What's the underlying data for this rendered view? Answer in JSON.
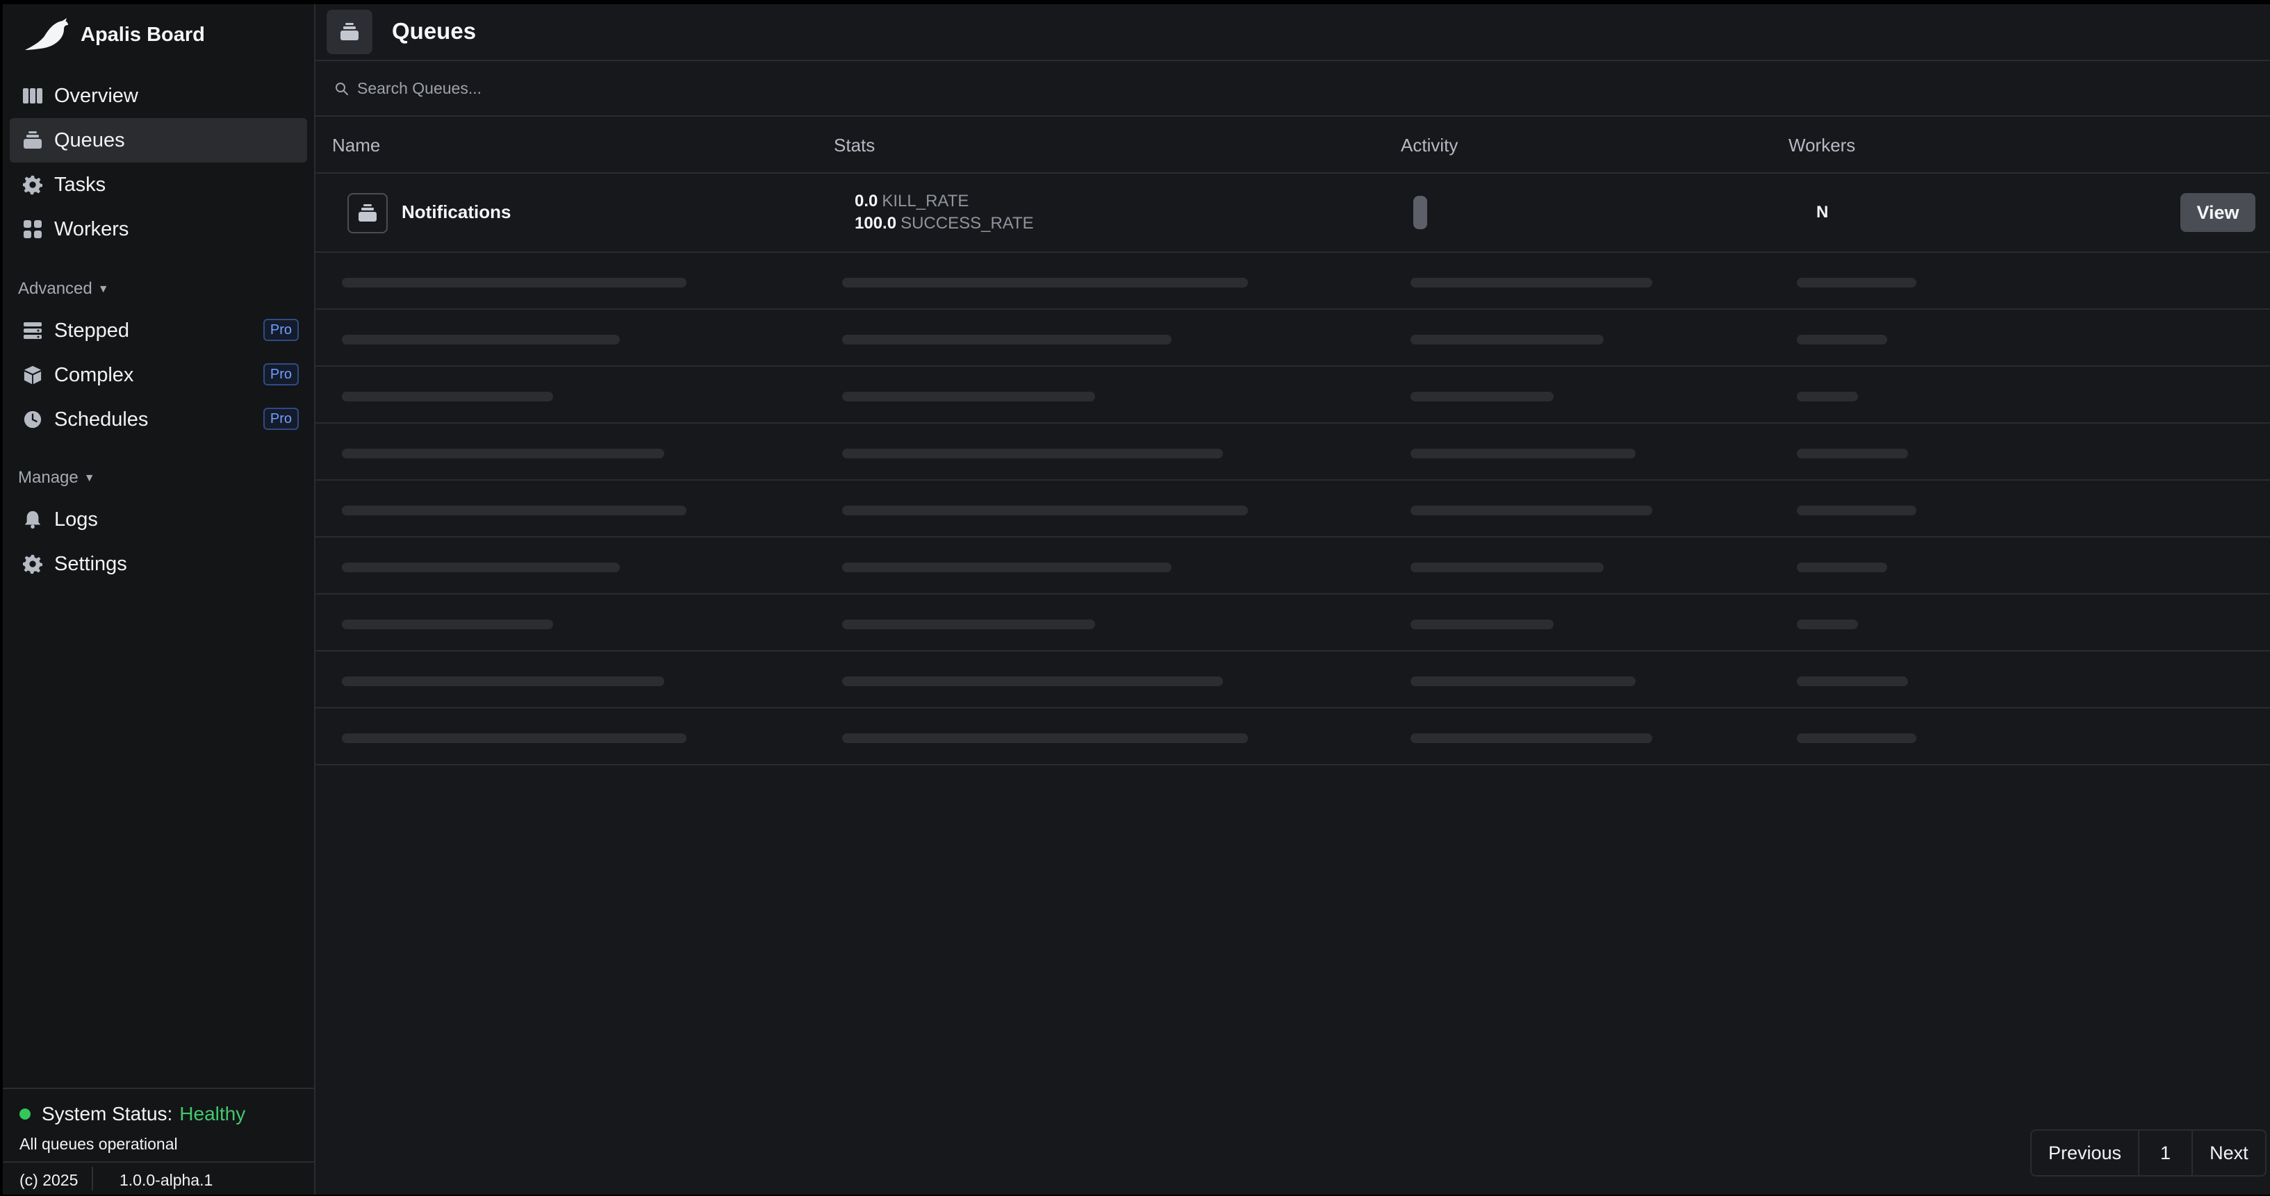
{
  "app": {
    "title": "Apalis Board"
  },
  "sidebar": {
    "items": [
      {
        "label": "Overview",
        "icon": "columns-icon"
      },
      {
        "label": "Queues",
        "icon": "inbox-icon"
      },
      {
        "label": "Tasks",
        "icon": "gear-icon"
      },
      {
        "label": "Workers",
        "icon": "grid-icon"
      }
    ],
    "advanced_label": "Advanced",
    "advanced_items": [
      {
        "label": "Stepped",
        "badge": "Pro",
        "icon": "stack-icon"
      },
      {
        "label": "Complex",
        "badge": "Pro",
        "icon": "cube-icon"
      },
      {
        "label": "Schedules",
        "badge": "Pro",
        "icon": "clock-icon"
      }
    ],
    "manage_label": "Manage",
    "manage_items": [
      {
        "label": "Logs",
        "icon": "bell-icon"
      },
      {
        "label": "Settings",
        "icon": "gear-icon"
      }
    ],
    "status": {
      "label": "System Status:",
      "value": "Healthy",
      "sub": "All queues operational",
      "color": "#42c86e"
    },
    "footer": {
      "copyright": "(c) 2025",
      "version": "1.0.0-alpha.1"
    }
  },
  "page": {
    "title": "Queues",
    "icon": "inbox-icon"
  },
  "search": {
    "placeholder": "Search Queues...",
    "value": ""
  },
  "table": {
    "headers": [
      "Name",
      "Stats",
      "Activity",
      "Workers"
    ],
    "rows": [
      {
        "name": "Notifications",
        "stats": [
          {
            "value": "0.0",
            "key": "KILL_RATE"
          },
          {
            "value": "100.0",
            "key": "SUCCESS_RATE"
          }
        ],
        "workers": "N",
        "action": "View"
      }
    ]
  },
  "pagination": {
    "previous": "Previous",
    "page": "1",
    "next": "Next"
  }
}
